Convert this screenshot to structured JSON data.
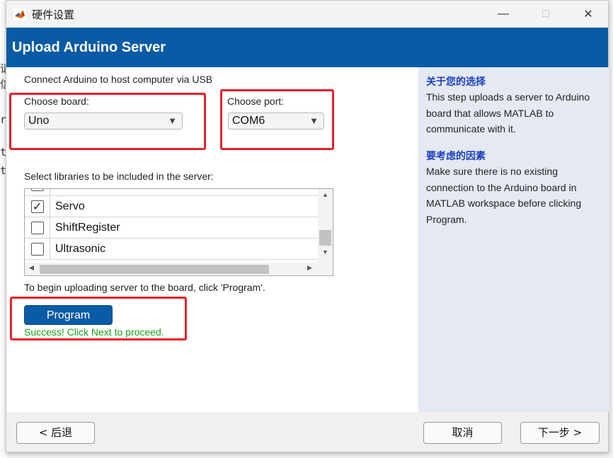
{
  "window": {
    "title": "硬件设置",
    "header_title": "Upload Arduino Server"
  },
  "main": {
    "intro": "Connect Arduino to host computer via USB",
    "board_label": "Choose board:",
    "board_value": "Uno",
    "port_label": "Choose port:",
    "port_value": "COM6",
    "libraries_label": "Select libraries to be included in the server:",
    "libraries": [
      {
        "label": "Servo",
        "checked": true
      },
      {
        "label": "ShiftRegister",
        "checked": false
      },
      {
        "label": "Ultrasonic",
        "checked": false
      }
    ],
    "upload_hint": "To begin uploading server to the board, click 'Program'.",
    "program_button": "Program",
    "status": "Success! Click Next to proceed.",
    "status_color": "#1aa01a"
  },
  "side": {
    "heading1": "关于您的选择",
    "text1": "This step uploads a server to Arduino board that allows MATLAB to communicate with it.",
    "heading2": "要考虑的因素",
    "text2": "Make sure there is no existing connection to the Arduino board in MATLAB workspace before clicking Program."
  },
  "footer": {
    "back": "< 后退",
    "cancel": "取消",
    "next": "下一步 >"
  },
  "colors": {
    "header": "#0a5ba5",
    "highlight": "#e8202a",
    "side_heading": "#1a3fc0"
  }
}
